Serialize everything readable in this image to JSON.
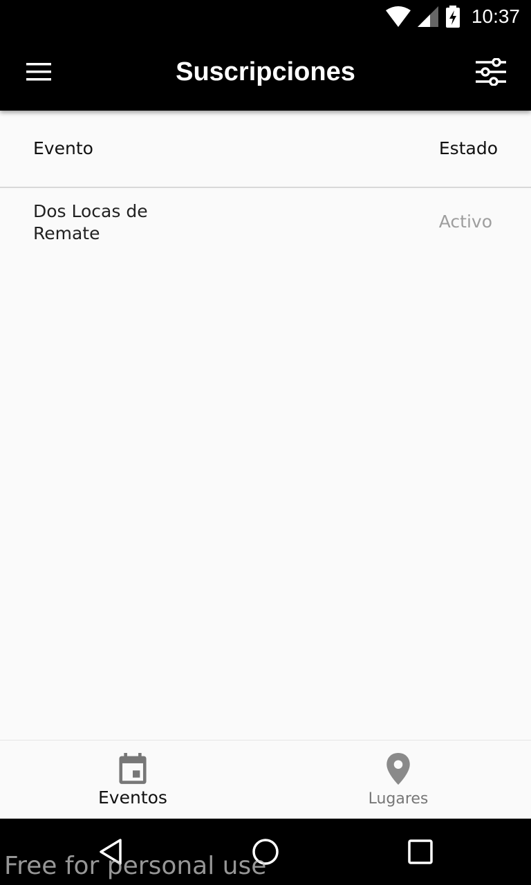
{
  "status_bar": {
    "time": "10:37",
    "icons": [
      "wifi-icon",
      "signal-icon",
      "battery-charging-icon"
    ]
  },
  "app_bar": {
    "title": "Suscripciones",
    "menu_icon": "menu-icon",
    "filter_icon": "sliders-icon"
  },
  "table": {
    "headers": {
      "event": "Evento",
      "status": "Estado"
    },
    "rows": [
      {
        "event": "Dos Locas de Remate",
        "status": "Activo"
      }
    ]
  },
  "bottom_nav": {
    "items": [
      {
        "label": "Eventos",
        "icon": "calendar-icon",
        "active": true
      },
      {
        "label": "Lugares",
        "icon": "location-pin-icon",
        "active": false
      }
    ]
  },
  "system_nav": {
    "icons": [
      "back-icon",
      "home-icon",
      "recents-icon"
    ]
  },
  "watermark": "Free for personal use",
  "colors": {
    "bar_background": "#000000",
    "page_background": "#fafafa",
    "inactive_text": "#9e9e9e"
  }
}
